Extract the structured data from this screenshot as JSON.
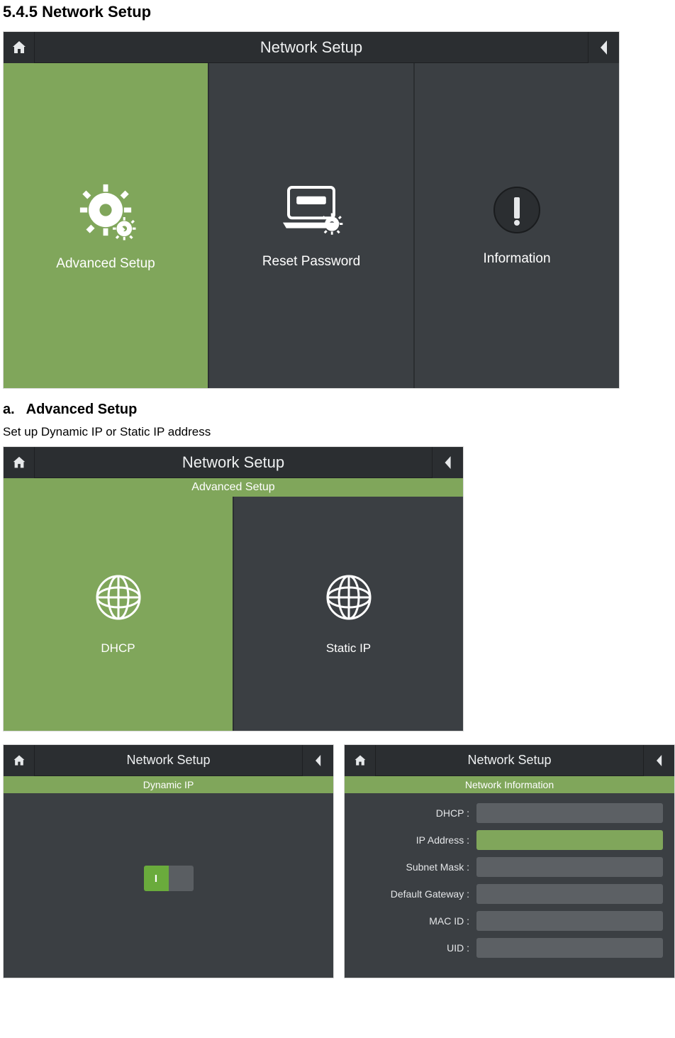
{
  "doc": {
    "section_number": "5.4.5",
    "section_title": "Network Setup",
    "sub_a_marker": "a.",
    "sub_a_title": "Advanced Setup",
    "sub_a_body": "Set up Dynamic IP or Static IP address"
  },
  "shot1": {
    "title": "Network Setup",
    "tiles": [
      {
        "label": "Advanced Setup",
        "icon": "gear-icon",
        "active": true
      },
      {
        "label": "Reset Password",
        "icon": "laptop-gear-icon",
        "active": false
      },
      {
        "label": "Information",
        "icon": "info-icon",
        "active": false
      }
    ]
  },
  "shot2": {
    "title": "Network Setup",
    "subtitle": "Advanced Setup",
    "tiles": [
      {
        "label": "DHCP",
        "icon": "globe-icon",
        "active": true
      },
      {
        "label": "Static IP",
        "icon": "globe-icon",
        "active": false
      }
    ]
  },
  "shot3": {
    "title": "Network Setup",
    "subtitle": "Dynamic IP",
    "toggle_state": "I"
  },
  "shot4": {
    "title": "Network Setup",
    "subtitle": "Network Information",
    "fields": [
      {
        "label": "DHCP :",
        "value": "",
        "focus": false
      },
      {
        "label": "IP Address :",
        "value": "",
        "focus": true
      },
      {
        "label": "Subnet Mask :",
        "value": "",
        "focus": false
      },
      {
        "label": "Default Gateway :",
        "value": "",
        "focus": false
      },
      {
        "label": "MAC ID :",
        "value": "",
        "focus": false
      },
      {
        "label": "UID :",
        "value": "",
        "focus": false
      }
    ]
  },
  "icons": {
    "home": "home-icon",
    "back": "chevron-left-icon"
  }
}
